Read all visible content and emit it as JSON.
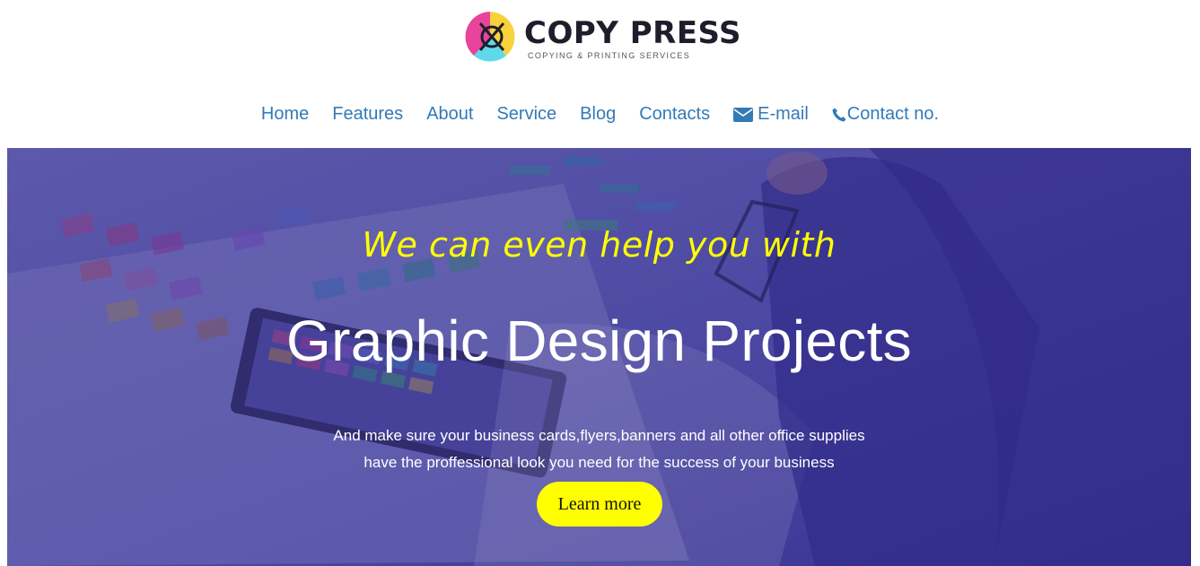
{
  "brand": {
    "name": "COPY PRESS",
    "tagline": "COPYING & PRINTING SERVICES",
    "colors": {
      "magenta": "#e8449b",
      "yellow": "#f7d23a",
      "cyan": "#5fd9ea",
      "dark": "#1d1d2b"
    }
  },
  "nav": {
    "items": [
      {
        "label": "Home"
      },
      {
        "label": "Features"
      },
      {
        "label": "About"
      },
      {
        "label": "Service"
      },
      {
        "label": "Blog"
      },
      {
        "label": "Contacts"
      },
      {
        "label": "E-mail",
        "icon": "envelope-icon"
      },
      {
        "label": "Contact no.",
        "icon": "phone-icon"
      }
    ],
    "link_color": "#337ab7"
  },
  "hero": {
    "subtitle": "We can even help you with",
    "title": "Graphic Design Projects",
    "text_line1": "And make sure your business cards,flyers,banners and all other office supplies",
    "text_line2": "have the proffessional look you need for the success of your business",
    "button_label": "Learn more",
    "accent_color": "#ffff00",
    "overlay_color": "#3e3e8f"
  }
}
